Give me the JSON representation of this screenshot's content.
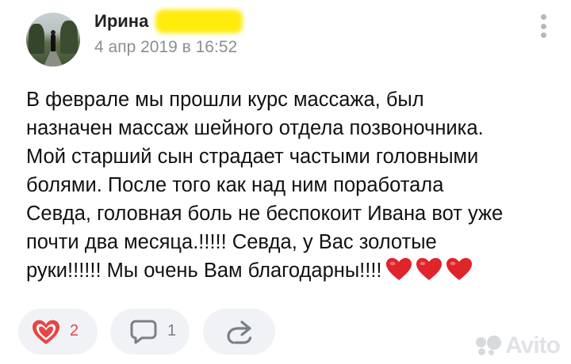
{
  "post": {
    "author_name": "Ирина",
    "date": "4 апр 2019 в 16:52",
    "text_lines": [
      "В феврале мы прошли курс массажа, был",
      "назначен массаж шейного отдела позвоночника.",
      "Мой старший сын страдает частыми головными",
      "болями. После того как над ним поработала",
      "Севда, головная боль не беспокоит Ивана вот уже",
      "почти два месяца.!!!!! Севда, у Вас золотые",
      "руки!!!!!! Мы очень Вам благодарны!!!!"
    ],
    "emoji_icons": [
      "heart-icon",
      "heart-icon",
      "heart-icon"
    ]
  },
  "actions": {
    "like_count": "2",
    "comment_count": "1"
  },
  "watermark": {
    "text": "Avito"
  },
  "colors": {
    "like_accent": "#e64646",
    "pill_bg": "#f0f2f5",
    "date_gray": "#8a8f96",
    "name_highlight": "#ffea00",
    "emoji_heart": "#e0242c"
  },
  "icons": {
    "more": "vertical-dots-icon",
    "like": "heart-icon",
    "comment": "speech-bubble-icon",
    "share": "share-arrow-icon"
  }
}
